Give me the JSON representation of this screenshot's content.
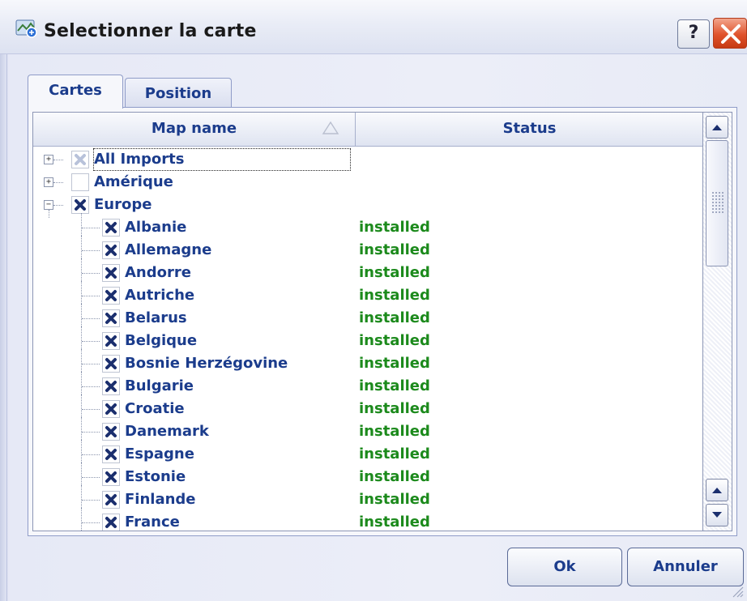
{
  "window": {
    "title": "Selectionner la carte",
    "help_label": "?"
  },
  "tabs": [
    {
      "label": "Cartes"
    },
    {
      "label": "Position"
    }
  ],
  "table": {
    "columns": [
      {
        "label": "Map name"
      },
      {
        "label": "Status"
      }
    ],
    "rows": [
      {
        "name": "All Imports",
        "status": "",
        "level": 0,
        "expander": "+",
        "checked": true,
        "dim": true
      },
      {
        "name": "Amérique",
        "status": "",
        "level": 0,
        "expander": "+",
        "checked": false,
        "dim": false
      },
      {
        "name": "Europe",
        "status": "",
        "level": 0,
        "expander": "-",
        "checked": true,
        "dim": false
      },
      {
        "name": "Albanie",
        "status": "installed",
        "level": 1,
        "checked": true
      },
      {
        "name": "Allemagne",
        "status": "installed",
        "level": 1,
        "checked": true
      },
      {
        "name": "Andorre",
        "status": "installed",
        "level": 1,
        "checked": true
      },
      {
        "name": "Autriche",
        "status": "installed",
        "level": 1,
        "checked": true
      },
      {
        "name": "Belarus",
        "status": "installed",
        "level": 1,
        "checked": true
      },
      {
        "name": "Belgique",
        "status": "installed",
        "level": 1,
        "checked": true
      },
      {
        "name": "Bosnie Herzégovine",
        "status": "installed",
        "level": 1,
        "checked": true
      },
      {
        "name": "Bulgarie",
        "status": "installed",
        "level": 1,
        "checked": true
      },
      {
        "name": "Croatie",
        "status": "installed",
        "level": 1,
        "checked": true
      },
      {
        "name": "Danemark",
        "status": "installed",
        "level": 1,
        "checked": true
      },
      {
        "name": "Espagne",
        "status": "installed",
        "level": 1,
        "checked": true
      },
      {
        "name": "Estonie",
        "status": "installed",
        "level": 1,
        "checked": true
      },
      {
        "name": "Finlande",
        "status": "installed",
        "level": 1,
        "checked": true
      },
      {
        "name": "France",
        "status": "installed",
        "level": 1,
        "checked": true
      }
    ]
  },
  "buttons": {
    "ok": "Ok",
    "cancel": "Annuler"
  },
  "colors": {
    "label": "#1b3c8c",
    "status": "#1c8a1c",
    "check": "#1b2f6e"
  }
}
